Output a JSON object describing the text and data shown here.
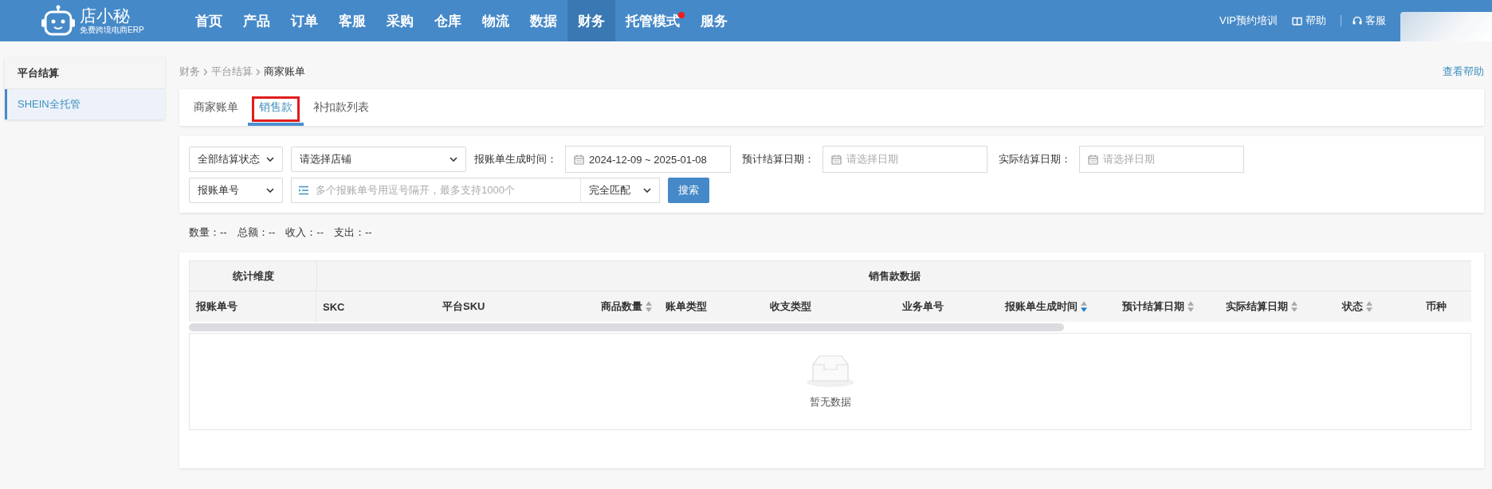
{
  "header": {
    "logo": {
      "name": "店小秘",
      "tagline": "免费跨境电商ERP"
    },
    "nav": [
      {
        "label": "首页",
        "selected": false,
        "dot": false
      },
      {
        "label": "产品",
        "selected": false,
        "dot": false
      },
      {
        "label": "订单",
        "selected": false,
        "dot": false
      },
      {
        "label": "客服",
        "selected": false,
        "dot": false
      },
      {
        "label": "采购",
        "selected": false,
        "dot": false
      },
      {
        "label": "仓库",
        "selected": false,
        "dot": false
      },
      {
        "label": "物流",
        "selected": false,
        "dot": false
      },
      {
        "label": "数据",
        "selected": false,
        "dot": false
      },
      {
        "label": "财务",
        "selected": true,
        "dot": false
      },
      {
        "label": "托管模式",
        "selected": false,
        "dot": true
      },
      {
        "label": "服务",
        "selected": false,
        "dot": false
      }
    ],
    "links": [
      {
        "kind": "text",
        "label": "VIP预约培训"
      },
      {
        "kind": "book",
        "label": "帮助"
      },
      {
        "kind": "headset",
        "label": "客服"
      }
    ]
  },
  "sidebar": {
    "title": "平台结算",
    "items": [
      {
        "label": "SHEIN全托管",
        "selected": true
      }
    ]
  },
  "breadcrumb": [
    "财务",
    "平台结算",
    "商家账单"
  ],
  "help_link": "查看帮助",
  "tabs": [
    {
      "label": "商家账单",
      "selected": false,
      "highlighted": false
    },
    {
      "label": "销售款",
      "selected": true,
      "highlighted": true
    },
    {
      "label": "补扣款列表",
      "selected": false,
      "highlighted": false
    }
  ],
  "filters": [
    [
      {
        "kind": "select",
        "value": "全部结算状态"
      },
      {
        "kind": "select",
        "value": "请选择店铺"
      },
      {
        "kind": "date",
        "label": "报账单生成时间：",
        "value": "2024-12-09 ~ 2025-01-08"
      },
      {
        "kind": "date",
        "label": "预计结算日期：",
        "placeholder": "请选择日期"
      },
      {
        "kind": "date",
        "label": "实际结算日期：",
        "placeholder": "请选择日期"
      }
    ],
    [
      {
        "kind": "select",
        "value": "报账单号"
      },
      {
        "kind": "multi",
        "placeholder": "多个报账单号用逗号隔开，最多支持1000个",
        "match": "完全匹配"
      },
      {
        "kind": "button",
        "label": "搜索"
      }
    ]
  ],
  "summary": [
    {
      "label": "数量：",
      "value": "--"
    },
    {
      "label": "总额：",
      "value": "--"
    },
    {
      "label": "收入：",
      "value": "--"
    },
    {
      "label": "支出：",
      "value": "--"
    }
  ],
  "table": {
    "groups": [
      "统计维度",
      "销售款数据"
    ],
    "columns": [
      {
        "label": "报账单号"
      },
      {
        "label": "SKC"
      },
      {
        "label": "平台SKU"
      },
      {
        "label": "商品数量",
        "sorted": false
      },
      {
        "label": "账单类型"
      },
      {
        "label": "收支类型"
      },
      {
        "label": "业务单号"
      },
      {
        "label": "报账单生成时间",
        "sorted": true
      },
      {
        "label": "预计结算日期",
        "sorted": false
      },
      {
        "label": "实际结算日期",
        "sorted": false
      },
      {
        "label": "状态",
        "sorted": false
      },
      {
        "label": "币种"
      }
    ],
    "empty_text": "暂无数据"
  }
}
